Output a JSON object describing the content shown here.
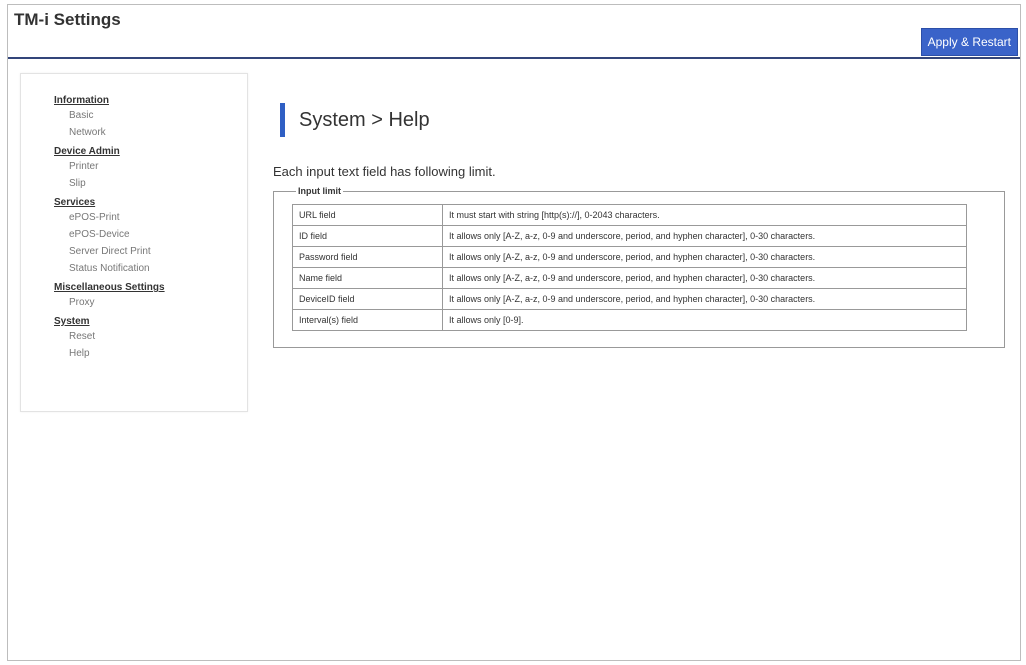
{
  "header": {
    "title": "TM-i Settings",
    "apply_button": "Apply & Restart",
    "accent_color": "#3a63c9"
  },
  "sidebar": {
    "sections": [
      {
        "heading": "Information",
        "items": [
          "Basic",
          "Network"
        ]
      },
      {
        "heading": "Device Admin",
        "items": [
          "Printer",
          "Slip"
        ]
      },
      {
        "heading": "Services",
        "items": [
          "ePOS-Print",
          "ePOS-Device",
          "Server Direct Print",
          "Status Notification"
        ]
      },
      {
        "heading": "Miscellaneous Settings",
        "items": [
          "Proxy"
        ]
      },
      {
        "heading": "System",
        "items": [
          "Reset",
          "Help"
        ]
      }
    ]
  },
  "main": {
    "page_title": "System > Help",
    "description": "Each input text field has following limit.",
    "fieldset_legend": "Input limit",
    "rows": [
      {
        "field": "URL field",
        "limit": "It must start with string [http(s)://], 0-2043 characters."
      },
      {
        "field": "ID field",
        "limit": "It allows only [A-Z, a-z, 0-9 and underscore, period, and hyphen character], 0-30 characters."
      },
      {
        "field": "Password field",
        "limit": "It allows only [A-Z, a-z, 0-9 and underscore, period, and hyphen character], 0-30 characters."
      },
      {
        "field": "Name field",
        "limit": "It allows only [A-Z, a-z, 0-9 and underscore, period, and hyphen character], 0-30 characters."
      },
      {
        "field": "DeviceID field",
        "limit": "It allows only [A-Z, a-z, 0-9 and underscore, period, and hyphen character], 0-30 characters."
      },
      {
        "field": "Interval(s) field",
        "limit": "It allows only [0-9]."
      }
    ]
  }
}
